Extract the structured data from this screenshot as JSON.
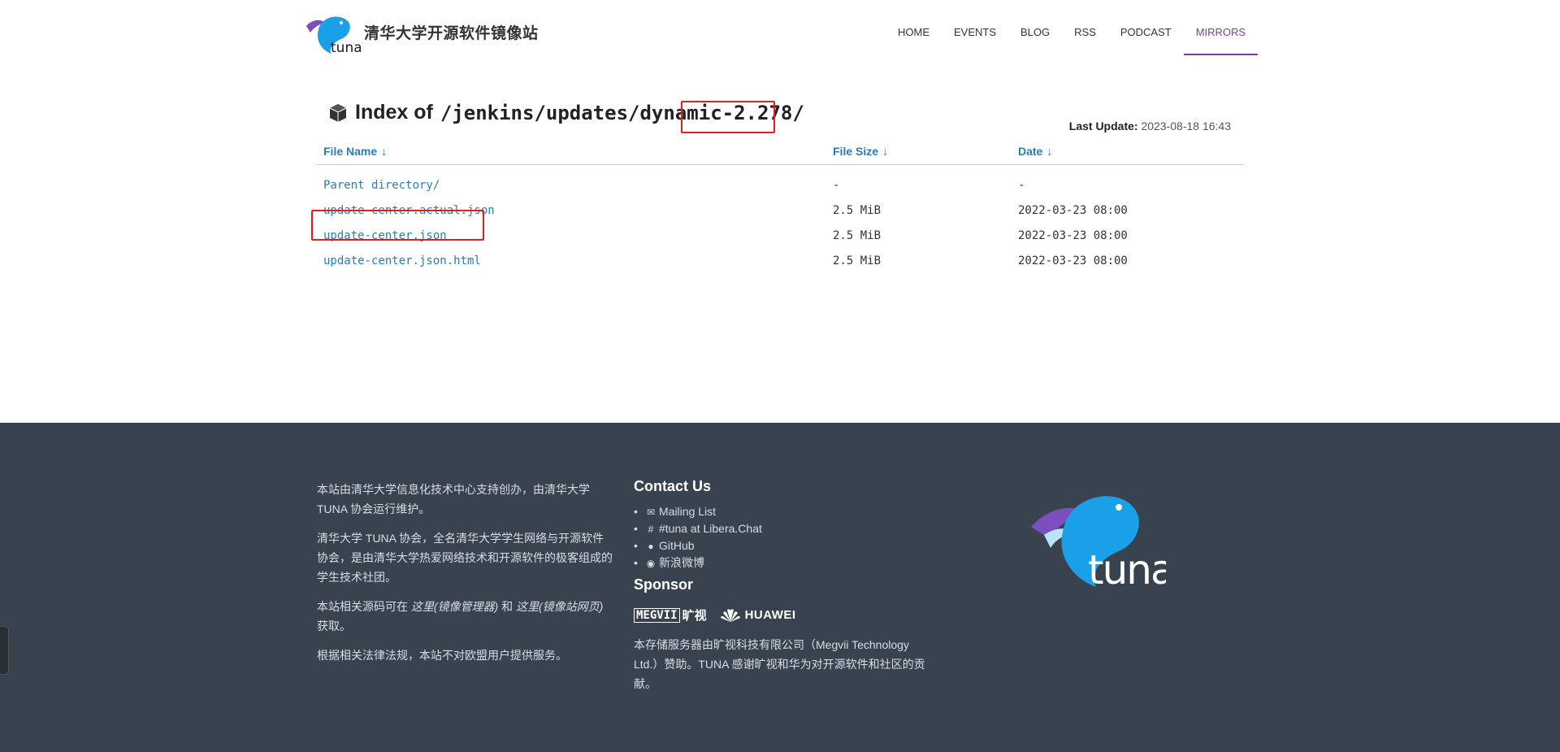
{
  "header": {
    "site_title": "清华大学开源软件镜像站",
    "nav": [
      {
        "label": "HOME"
      },
      {
        "label": "EVENTS"
      },
      {
        "label": "BLOG"
      },
      {
        "label": "RSS"
      },
      {
        "label": "PODCAST"
      },
      {
        "label": "MIRRORS",
        "active": true
      }
    ]
  },
  "main": {
    "title_prefix": "Index of",
    "path_base": "/jenkins/updates/dynami",
    "path_mid": "c",
    "path_version": "-2.278/",
    "last_update_label": "Last Update:",
    "last_update_value": "2023-08-18 16:43",
    "columns": [
      {
        "label": "File Name",
        "arrow": "↓"
      },
      {
        "label": "File Size",
        "arrow": "↓"
      },
      {
        "label": "Date",
        "arrow": "↓"
      }
    ],
    "rows": [
      {
        "name": "Parent directory/",
        "size": "-",
        "date": "-"
      },
      {
        "name": "update-center.actual.json",
        "size": "2.5 MiB",
        "date": "2022-03-23 08:00"
      },
      {
        "name": "update-center.json",
        "size": "2.5 MiB",
        "date": "2022-03-23 08:00"
      },
      {
        "name": "update-center.json.html",
        "size": "2.5 MiB",
        "date": "2022-03-23 08:00"
      }
    ]
  },
  "footer": {
    "about_p1": "本站由清华大学信息化技术中心支持创办，由清华大学 TUNA 协会运行维护。",
    "about_p2": "清华大学 TUNA 协会，全名清华大学学生网络与开源软件协会，是由清华大学热爱网络技术和开源软件的极客组成的学生技术社团。",
    "about_p3_a": "本站相关源码可在 ",
    "about_p3_link1": "这里(镜像管理器)",
    "about_p3_b": " 和 ",
    "about_p3_link2": "这里(镜像站网页)",
    "about_p3_c": " 获取。",
    "about_p4": "根据相关法律法规，本站不对欧盟用户提供服务。",
    "contact_title": "Contact Us",
    "contact_items": [
      {
        "icon": "mail-icon",
        "label": "Mailing List"
      },
      {
        "icon": "hashtag-icon",
        "label": "#tuna at Libera.Chat"
      },
      {
        "icon": "github-icon",
        "label": "GitHub"
      },
      {
        "icon": "weibo-icon",
        "label": "新浪微博"
      }
    ],
    "sponsor_title": "Sponsor",
    "sponsor_megvii": "MEGVII",
    "sponsor_megvii_cn": "旷视",
    "sponsor_huawei": "HUAWEI",
    "sponsor_note": "本存储服务器由旷视科技有限公司（Megvii Technology Ltd.）赞助。TUNA 感谢旷视和华为对开源软件和社区的贡献。"
  },
  "colors": {
    "link": "#2c7cb8",
    "accent": "#7b3f9a",
    "footer_bg": "#394350",
    "highlight": "#e02020",
    "logo_blue": "#1aa0e8"
  }
}
